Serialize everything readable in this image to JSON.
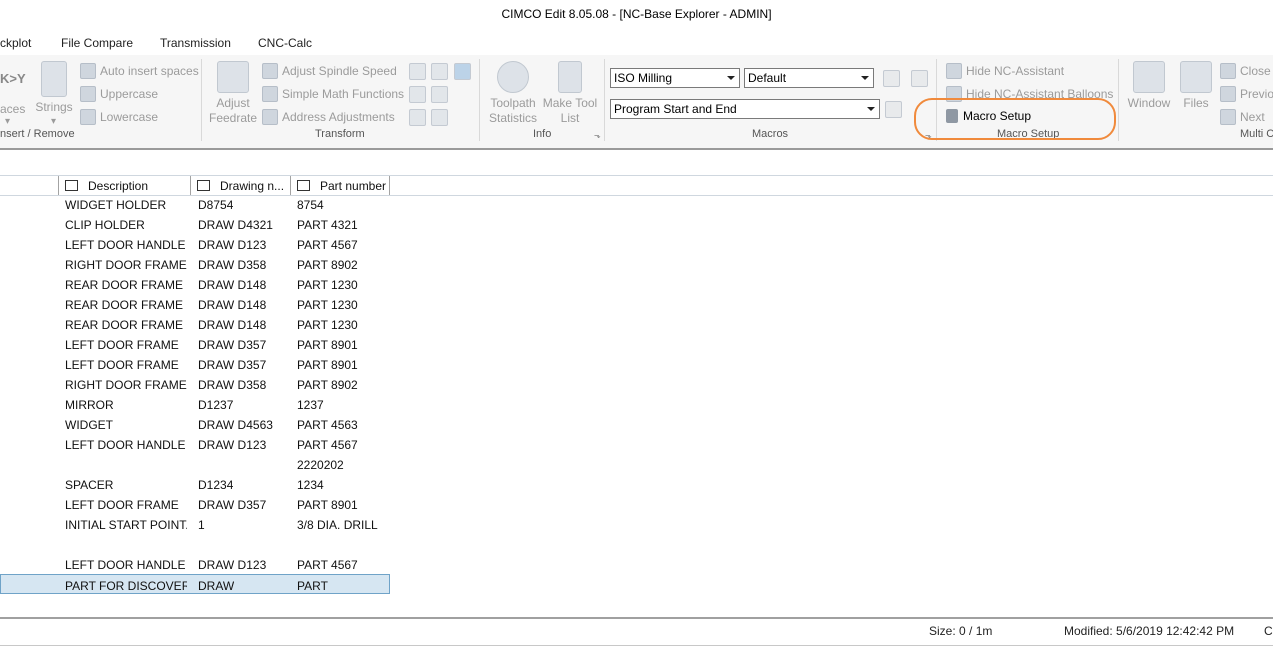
{
  "window": {
    "title": "CIMCO Edit 8.05.08 - [NC-Base Explorer - ADMIN]"
  },
  "menu": [
    "ckplot",
    "File Compare",
    "Transmission",
    "CNC-Calc"
  ],
  "ribbon": {
    "insert_remove": {
      "partial_icon_text": "K>Y",
      "auto_insert_spaces": "Auto insert spaces",
      "uppercase": "Uppercase",
      "lowercase": "Lowercase",
      "spaces": "aces",
      "spaces_arrow": "▾",
      "strings": "Strings",
      "strings_arrow": "▾",
      "group_title": "nsert / Remove"
    },
    "transform": {
      "adjust_feedrate": "Adjust Feedrate",
      "adjust_spindle_speed": "Adjust Spindle Speed",
      "simple_math_functions": "Simple Math Functions",
      "address_adjustments": "Address Adjustments",
      "group_title": "Transform"
    },
    "info": {
      "toolpath_statistics": "Toolpath Statistics",
      "make_tool_list": "Make Tool List",
      "group_title": "Info"
    },
    "macros": {
      "machine_select": "ISO Milling",
      "profile_select": "Default",
      "macro_select": "Program Start and End",
      "group_title": "Macros"
    },
    "macro_setup": {
      "hide_nc_assistant": "Hide NC-Assistant",
      "hide_nc_assistant_balloons": "Hide NC-Assistant Balloons",
      "macro_setup_button": "Macro Setup",
      "group_title": "Macro Setup"
    },
    "window_group": {
      "window": "Window",
      "files": "Files",
      "close": "Close",
      "previous": "Previo",
      "next": "Next",
      "group_title": "Multi C"
    }
  },
  "table": {
    "columns": [
      "Description",
      "Drawing n...",
      "Part number"
    ],
    "rows": [
      [
        "WIDGET HOLDER",
        "D8754",
        "8754"
      ],
      [
        "CLIP HOLDER",
        "DRAW D4321",
        "PART 4321"
      ],
      [
        "LEFT DOOR HANDLE",
        "DRAW D123",
        "PART 4567"
      ],
      [
        "RIGHT DOOR FRAME",
        "DRAW D358",
        "PART 8902"
      ],
      [
        "REAR DOOR FRAME",
        "DRAW D148",
        "PART 1230"
      ],
      [
        "REAR DOOR FRAME",
        "DRAW D148",
        "PART 1230"
      ],
      [
        "REAR DOOR FRAME",
        "DRAW D148",
        "PART 1230"
      ],
      [
        "LEFT DOOR FRAME",
        "DRAW D357",
        "PART 8901"
      ],
      [
        "LEFT DOOR FRAME",
        "DRAW D357",
        "PART 8901"
      ],
      [
        "RIGHT DOOR FRAME",
        "DRAW D358",
        "PART 8902"
      ],
      [
        "MIRROR",
        "D1237",
        "1237"
      ],
      [
        "WIDGET",
        "DRAW D4563",
        "PART 4563"
      ],
      [
        "LEFT DOOR HANDLE",
        "DRAW D123",
        "PART 4567"
      ],
      [
        "",
        "",
        "2220202"
      ],
      [
        "SPACER",
        "D1234",
        "1234"
      ],
      [
        "LEFT DOOR FRAME",
        "DRAW D357",
        "PART 8901"
      ],
      [
        "INITIAL START POINT...",
        "1",
        "3/8 DIA. DRILL"
      ],
      [
        "",
        "",
        ""
      ],
      [
        "LEFT DOOR HANDLE",
        "DRAW D123",
        "PART 4567"
      ],
      [
        "PART FOR DISCOVERY",
        "DRAW",
        "PART"
      ]
    ]
  },
  "status": {
    "size": "Size: 0 / 1m",
    "modified": "Modified: 5/6/2019 12:42:42 PM",
    "trailing": "C"
  },
  "colors": {
    "callout": "#f08a3c",
    "selection": "#d6e6f2"
  }
}
